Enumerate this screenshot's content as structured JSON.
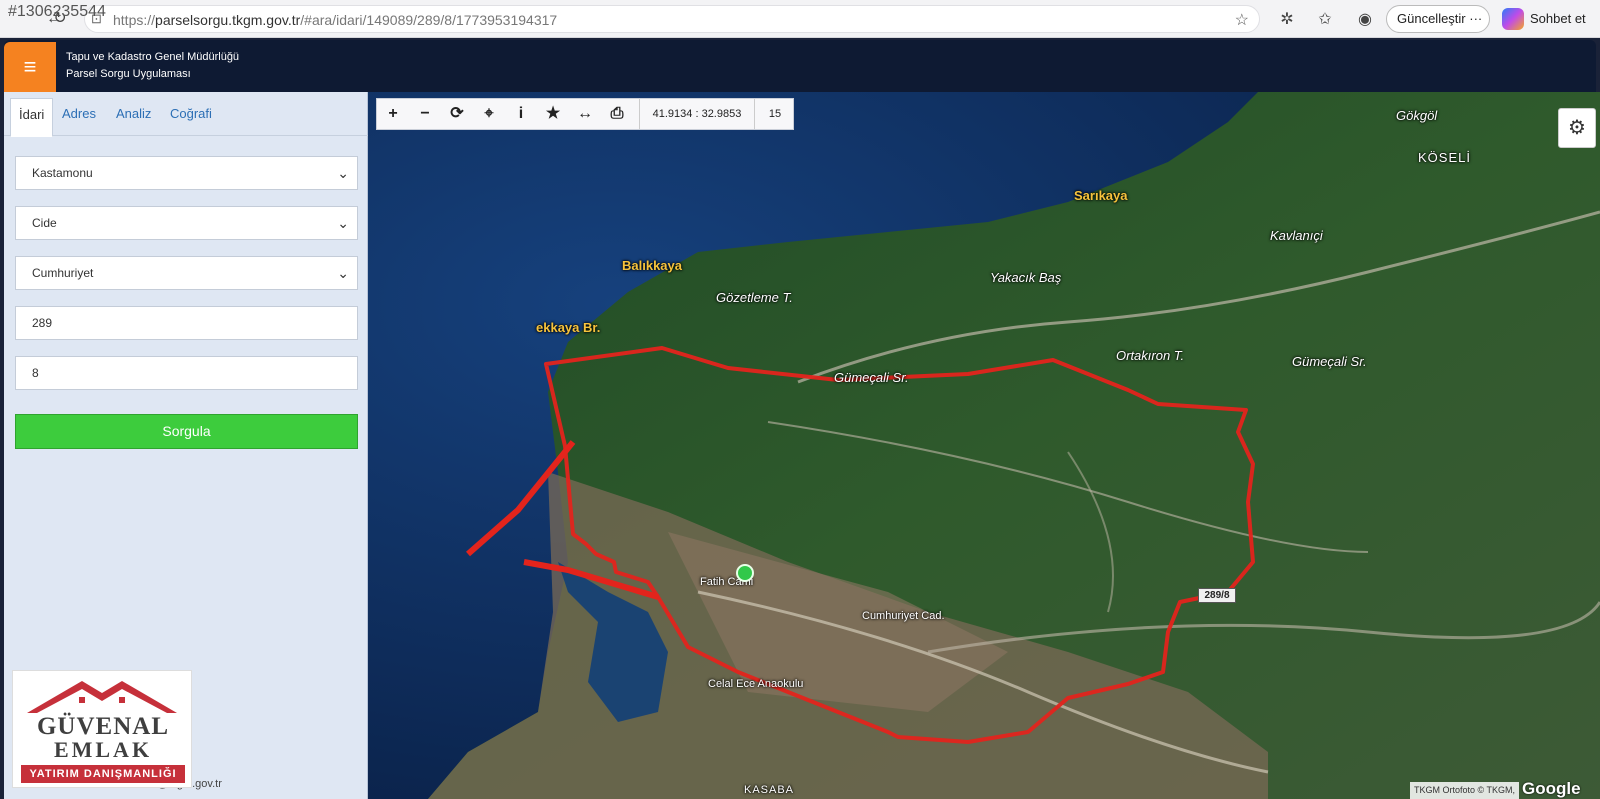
{
  "browser": {
    "watermark_id": "#1306235544",
    "url_scheme": "https://",
    "url_host": "parselsorgu.tkgm.gov.tr",
    "url_path": "/#ara/idari/149089/289/8/1773953194317",
    "update_label": "Güncelleştir",
    "copilot_label": "Sohbet et"
  },
  "header": {
    "line1": "Tapu ve Kadastro Genel Müdürlüğü",
    "line2": "Parsel Sorgu Uygulaması",
    "accent": "#f58220"
  },
  "side": {
    "tabs": [
      "İdari",
      "Adres",
      "Analiz",
      "Coğrafi"
    ],
    "active_tab": "İdari",
    "province": "Kastamonu",
    "district": "Cide",
    "neighborhood": "Cumhuriyet",
    "block": "289",
    "parcel": "8",
    "query_label": "Sorgula",
    "footer_mail": "cbs@tkgm.gov.tr",
    "brand": {
      "name1": "GÜVENAL",
      "name2": "EMLAK",
      "tag": "YATIRIM DANIŞMANLIĞI"
    }
  },
  "map": {
    "coords": "41.9134 : 32.9853",
    "zoom": "15",
    "parcel_label": "289/8",
    "parcel_color": "#e3241c",
    "labels": {
      "gokgol": "Gökgöl",
      "koseli": "KÖSELİ",
      "sarikaya": "Sarıkaya",
      "kavlanici": "Kavlanıçi",
      "balikkaya": "Balıkkaya",
      "yakacik": "Yakacık Baş",
      "gozetleme": "Gözetleme T.",
      "ekkaya": "ekkaya Br.",
      "ortakiron": "Ortakıron T.",
      "gumecali1": "Gümeçali Sr.",
      "gumecali2": "Gümeçali Sr.",
      "fatih": "Fatih Cami",
      "celal": "Celal Ece Anaokulu",
      "kasaba": "KASABA",
      "cumhuriyet_cd": "Cumhuriyet Cad."
    },
    "attribution": "TKGM Ortofoto © TKGM,",
    "google": "Google"
  }
}
